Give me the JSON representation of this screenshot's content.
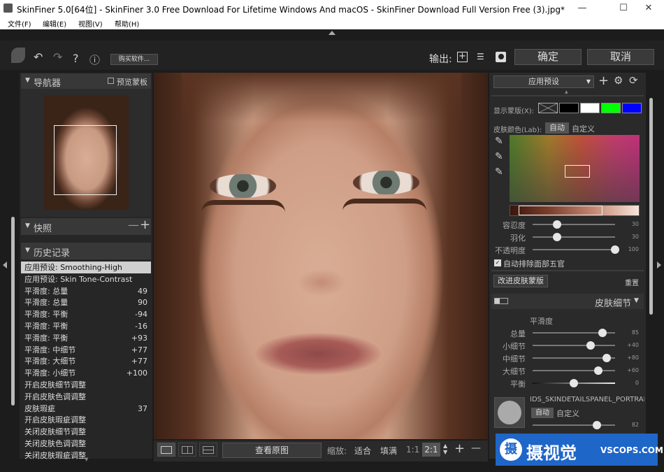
{
  "window": {
    "title": "SkinFiner 5.0[64位] - SkinFiner 3.0 Free Download For Lifetime Windows And macOS - SkinFiner Download Full Version Free (3).jpg*",
    "min": "—",
    "max": "☐",
    "close": "✕"
  },
  "menu": [
    "文件(F)",
    "编辑(E)",
    "视图(V)",
    "帮助(H)"
  ],
  "toolbar": {
    "buy": "购买软件...",
    "output": "输出:",
    "ok": "确定",
    "cancel": "取消",
    "help": "?",
    "info": "ⓘ",
    "undo": "↶",
    "redo": "↷"
  },
  "navigator": {
    "title": "导航器",
    "preview_mask": "预览蒙板"
  },
  "snapshot": {
    "title": "快照"
  },
  "history": {
    "title": "历史记录",
    "items": [
      {
        "name": "应用预设: Smoothing-High",
        "value": ""
      },
      {
        "name": "应用预设: Skin Tone-Contrast",
        "value": ""
      },
      {
        "name": "平滑度: 总量",
        "value": "49"
      },
      {
        "name": "平滑度: 总量",
        "value": "90"
      },
      {
        "name": "平滑度: 平衡",
        "value": "-94"
      },
      {
        "name": "平滑度: 平衡",
        "value": "-16"
      },
      {
        "name": "平滑度: 平衡",
        "value": "+93"
      },
      {
        "name": "平滑度: 中细节",
        "value": "+77"
      },
      {
        "name": "平滑度: 大细节",
        "value": "+77"
      },
      {
        "name": "平滑度: 小细节",
        "value": "+100"
      },
      {
        "name": "开启皮肤细节调整",
        "value": ""
      },
      {
        "name": "开启皮肤色调调整",
        "value": ""
      },
      {
        "name": "皮肤瑕疵",
        "value": "37"
      },
      {
        "name": "开启皮肤瑕疵调整",
        "value": ""
      },
      {
        "name": "关闭皮肤细节调整",
        "value": ""
      },
      {
        "name": "关闭皮肤色调调整",
        "value": ""
      },
      {
        "name": "关闭皮肤瑕疵调整",
        "value": ""
      }
    ]
  },
  "bottombar": {
    "view_original": "查看原图",
    "zoom": "缩放:",
    "fit": "适合",
    "fill": "填满",
    "r11": "1:1",
    "r21": "2:1",
    "plus": "+",
    "minus": "—"
  },
  "right": {
    "preset": "应用预设",
    "show_mask": "显示蒙版(X):",
    "mask_colors": [
      "#000000",
      "#ffffff",
      "#00ff00",
      "#0000ff"
    ],
    "skin_color": "皮肤颜色(Lab):",
    "auto": "自动",
    "custom": "自定义",
    "tolerance": {
      "label": "容忍度",
      "value": "30",
      "pct": 0.3
    },
    "feather": {
      "label": "羽化",
      "value": "30",
      "pct": 0.3
    },
    "opacity": {
      "label": "不透明度",
      "value": "100",
      "pct": 1.0
    },
    "exclude": "自动排除面部五官",
    "improve": "改进皮肤蒙版",
    "reset": "重置",
    "skin_detail": "皮肤细节",
    "smoothing": "平滑度",
    "amount": {
      "label": "总量",
      "value": "85",
      "pct": 0.85
    },
    "small": {
      "label": "小细节",
      "value": "+40",
      "pct": 0.7
    },
    "medium": {
      "label": "中细节",
      "value": "+80",
      "pct": 0.9
    },
    "large": {
      "label": "大细节",
      "value": "+60",
      "pct": 0.8
    },
    "balance": {
      "label": "平衡",
      "value": "0",
      "pct": 0.5
    },
    "ids": "IDS_SKINDETAILSPANEL_PORTRAI",
    "auto2": "自动",
    "custom2": "自定义",
    "last_value": "82"
  },
  "watermark": {
    "brand": "摄视觉",
    "site": "VSCOPS.COM"
  }
}
